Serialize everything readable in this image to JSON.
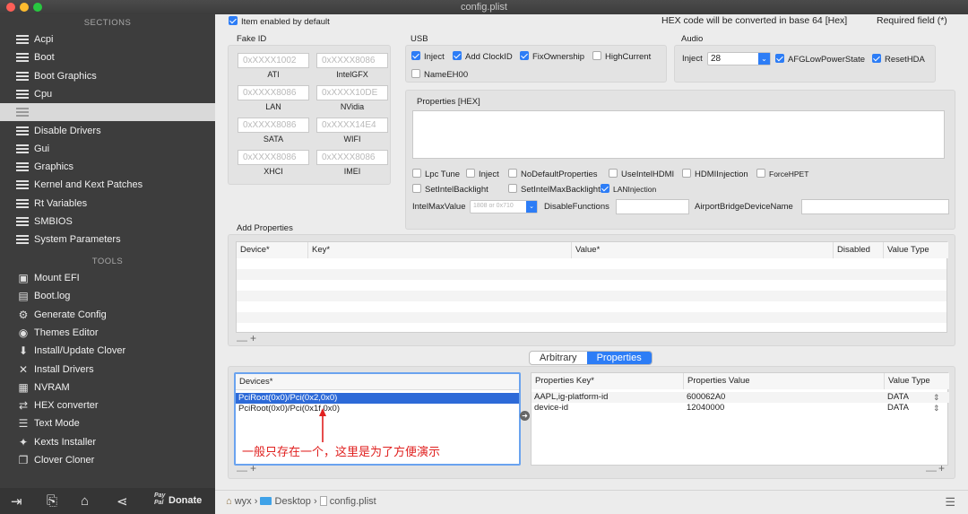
{
  "window": {
    "title": "config.plist",
    "traffic": [
      "#fe5f57",
      "#febc2e",
      "#28c840"
    ]
  },
  "sidebar": {
    "sections_header": "SECTIONS",
    "sections": [
      {
        "label": "Acpi",
        "selected": false
      },
      {
        "label": "Boot",
        "selected": false
      },
      {
        "label": "Boot Graphics",
        "selected": false
      },
      {
        "label": "Cpu",
        "selected": false
      },
      {
        "label": "",
        "selected": true
      },
      {
        "label": "Disable Drivers",
        "selected": false
      },
      {
        "label": "Gui",
        "selected": false
      },
      {
        "label": "Graphics",
        "selected": false
      },
      {
        "label": "Kernel and Kext Patches",
        "selected": false
      },
      {
        "label": "Rt Variables",
        "selected": false
      },
      {
        "label": "SMBIOS",
        "selected": false
      },
      {
        "label": "System Parameters",
        "selected": false
      }
    ],
    "tools_header": "TOOLS",
    "tools": [
      {
        "label": "Mount EFI",
        "icon": "disk-icon",
        "glyph": "▣"
      },
      {
        "label": "Boot.log",
        "icon": "document-icon",
        "glyph": "▤"
      },
      {
        "label": "Generate Config",
        "icon": "gears-icon",
        "glyph": "⚙"
      },
      {
        "label": "Themes Editor",
        "icon": "camera-icon",
        "glyph": "◉"
      },
      {
        "label": "Install/Update Clover",
        "icon": "download-icon",
        "glyph": "⬇"
      },
      {
        "label": "Install Drivers",
        "icon": "tools-icon",
        "glyph": "✕"
      },
      {
        "label": "NVRAM",
        "icon": "chip-icon",
        "glyph": "▦"
      },
      {
        "label": "HEX converter",
        "icon": "convert-icon",
        "glyph": "⇄"
      },
      {
        "label": "Text Mode",
        "icon": "text-icon",
        "glyph": "☰"
      },
      {
        "label": "Kexts Installer",
        "icon": "puzzle-icon",
        "glyph": "✦"
      },
      {
        "label": "Clover Cloner",
        "icon": "clone-icon",
        "glyph": "❐"
      }
    ],
    "footer": {
      "paypal_top": "Pay",
      "paypal_bottom": "Pal",
      "donate": "Donate"
    }
  },
  "header": {
    "item_enabled": "Item enabled by default",
    "hex_note": "HEX code will be converted in base 64 [Hex]",
    "required": "Required field (*)"
  },
  "fake_id": {
    "title": "Fake ID",
    "fields": [
      {
        "placeholder": "0xXXXX1002",
        "label": "ATI"
      },
      {
        "placeholder": "0xXXXX8086",
        "label": "IntelGFX"
      },
      {
        "placeholder": "0xXXXX8086",
        "label": "LAN"
      },
      {
        "placeholder": "0xXXXX10DE",
        "label": "NVidia"
      },
      {
        "placeholder": "0xXXXX8086",
        "label": "SATA"
      },
      {
        "placeholder": "0xXXXX14E4",
        "label": "WIFI"
      },
      {
        "placeholder": "0xXXXX8086",
        "label": "XHCI"
      },
      {
        "placeholder": "0xXXXX8086",
        "label": "IMEI"
      }
    ]
  },
  "usb": {
    "title": "USB",
    "options": [
      {
        "label": "Inject",
        "checked": true
      },
      {
        "label": "Add ClockID",
        "checked": true
      },
      {
        "label": "FixOwnership",
        "checked": true
      },
      {
        "label": "HighCurrent",
        "checked": false
      },
      {
        "label": "NameEH00",
        "checked": false
      }
    ]
  },
  "audio": {
    "title": "Audio",
    "inject_label": "Inject",
    "inject_value": "28",
    "afgl": {
      "label": "AFGLowPowerState",
      "checked": true
    },
    "reset": {
      "label": "ResetHDA",
      "checked": true
    }
  },
  "properties_hex": {
    "title": "Properties [HEX]",
    "value": ""
  },
  "flags": [
    {
      "label": "Lpc Tune",
      "checked": false
    },
    {
      "label": "Inject",
      "checked": false
    },
    {
      "label": "NoDefaultProperties",
      "checked": false
    },
    {
      "label": "UseIntelHDMI",
      "checked": false
    },
    {
      "label": "HDMIInjection",
      "checked": false
    },
    {
      "label": "ForceHPET",
      "checked": false
    },
    {
      "label": "SetIntelBacklight",
      "checked": false
    },
    {
      "label": "SetIntelMaxBacklight",
      "checked": false
    },
    {
      "label": "LANInjection",
      "checked": true
    }
  ],
  "intel": {
    "max_label": "IntelMaxValue",
    "max_placeholder": "1808 or 0x710",
    "disable_label": "DisableFunctions",
    "airport_label": "AirportBridgeDeviceName"
  },
  "add_properties": {
    "title": "Add Properties",
    "columns": [
      "Device*",
      "Key*",
      "Value*",
      "Disabled",
      "Value Type"
    ],
    "plus": "+",
    "minus": "—"
  },
  "tabs": [
    {
      "label": "Arbitrary",
      "active": false
    },
    {
      "label": "Properties",
      "active": true
    }
  ],
  "devices": {
    "header": "Devices*",
    "rows": [
      {
        "label": "PciRoot(0x0)/Pci(0x2,0x0)",
        "selected": true
      },
      {
        "label": "PciRoot(0x0)/Pci(0x1f,0x0)",
        "selected": false
      }
    ],
    "annotation": "一般只存在一个，这里是为了方便演示",
    "annotation_color": "#e0201f"
  },
  "properties_table": {
    "columns": [
      "Properties Key*",
      "Properties Value",
      "Value Type"
    ],
    "rows": [
      {
        "key": "AAPL,ig-platform-id",
        "value": "600062A0",
        "type": "DATA"
      },
      {
        "key": "device-id",
        "value": "12040000",
        "type": "DATA"
      }
    ]
  },
  "breadcrumb": [
    "wyx",
    "Desktop",
    "config.plist"
  ],
  "colors": {
    "accent": "#2d7df6",
    "sidebar": "#3d3d3d"
  }
}
